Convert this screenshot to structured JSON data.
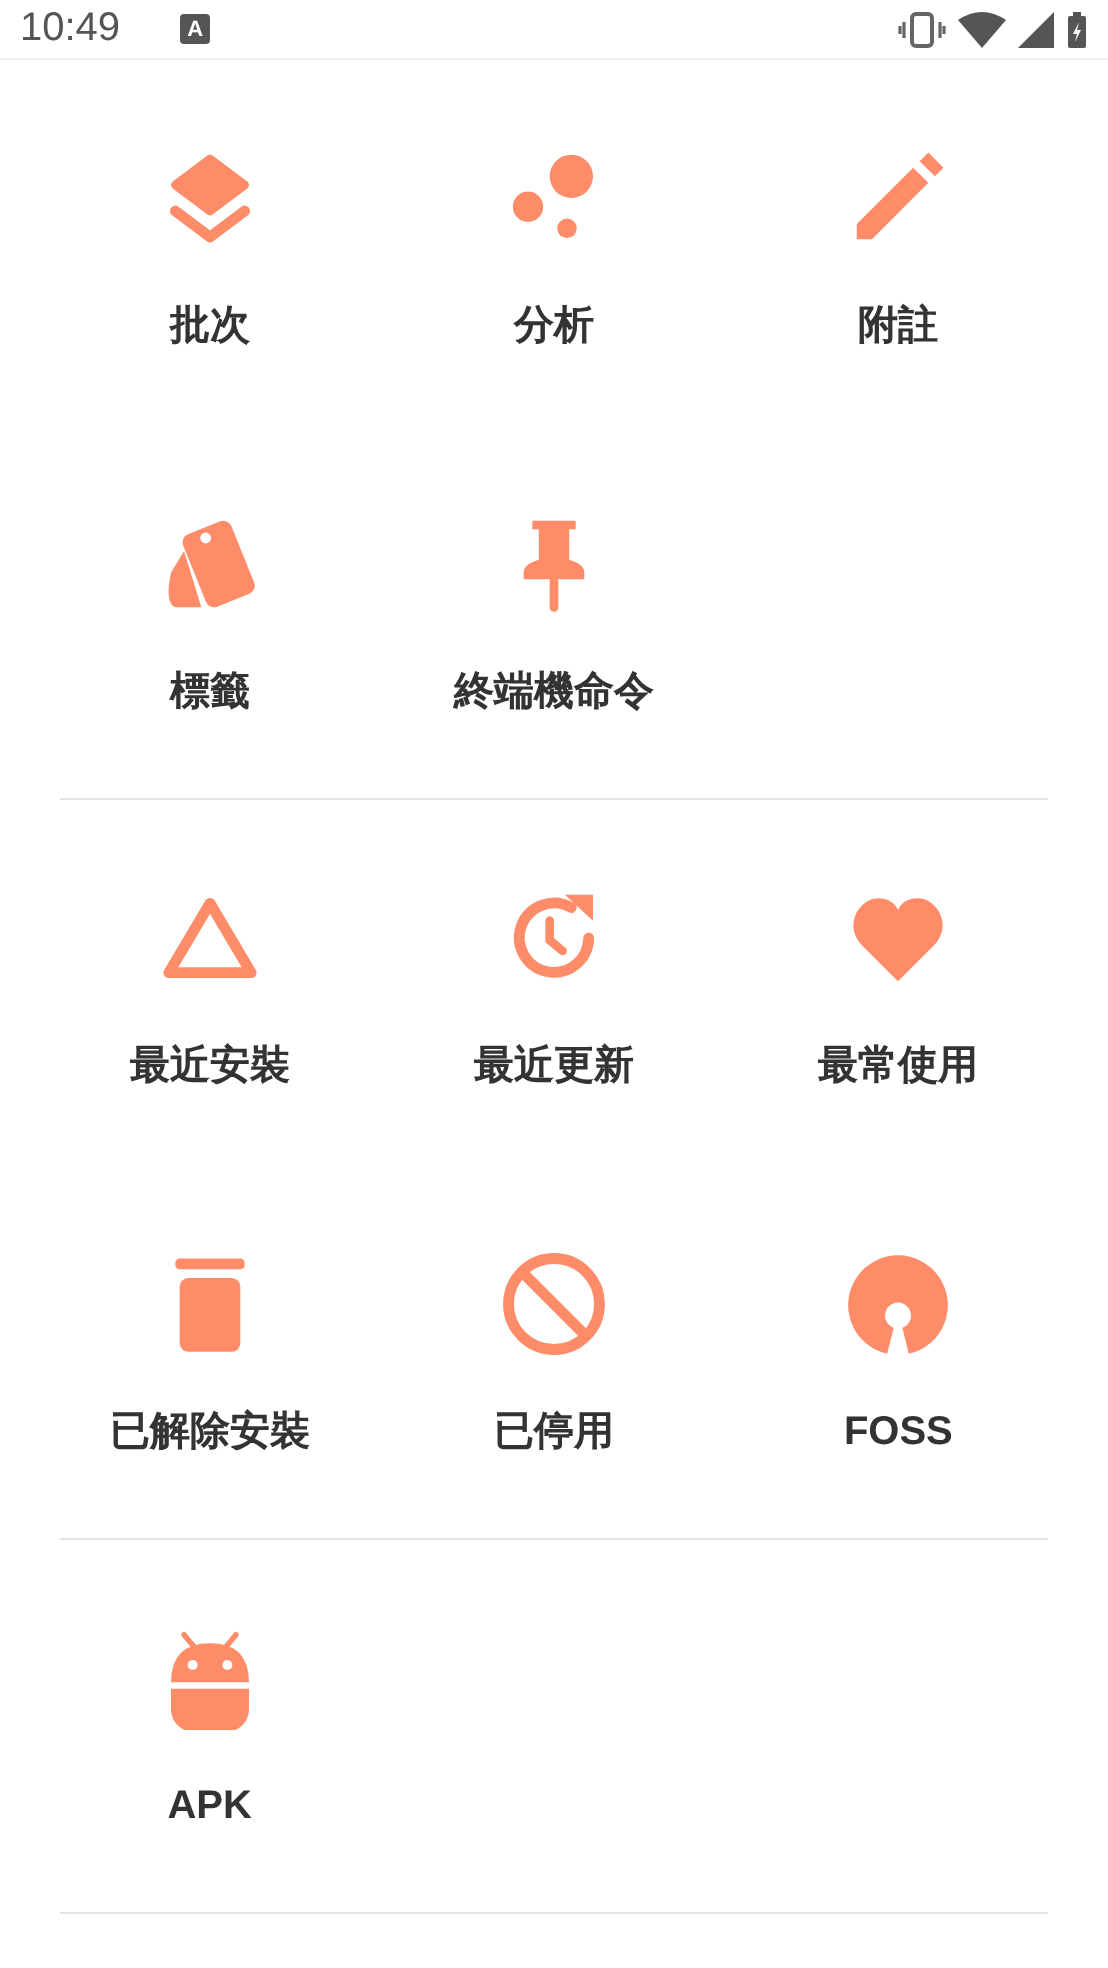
{
  "status_bar": {
    "time": "10:49",
    "notification_glyph": "A"
  },
  "sections": [
    {
      "items": [
        {
          "label": "批次",
          "kind": "layers"
        },
        {
          "label": "分析",
          "kind": "bubbles"
        },
        {
          "label": "附註",
          "kind": "pencil"
        },
        {
          "label": "標籤",
          "kind": "tags"
        },
        {
          "label": "終端機命令",
          "kind": "pin"
        }
      ]
    },
    {
      "items": [
        {
          "label": "最近安裝",
          "kind": "triangle"
        },
        {
          "label": "最近更新",
          "kind": "history"
        },
        {
          "label": "最常使用",
          "kind": "heart"
        },
        {
          "label": "已解除安裝",
          "kind": "trash"
        },
        {
          "label": "已停用",
          "kind": "block"
        },
        {
          "label": "FOSS",
          "kind": "opensource"
        }
      ]
    },
    {
      "items": [
        {
          "label": "APK",
          "kind": "android"
        }
      ]
    }
  ]
}
